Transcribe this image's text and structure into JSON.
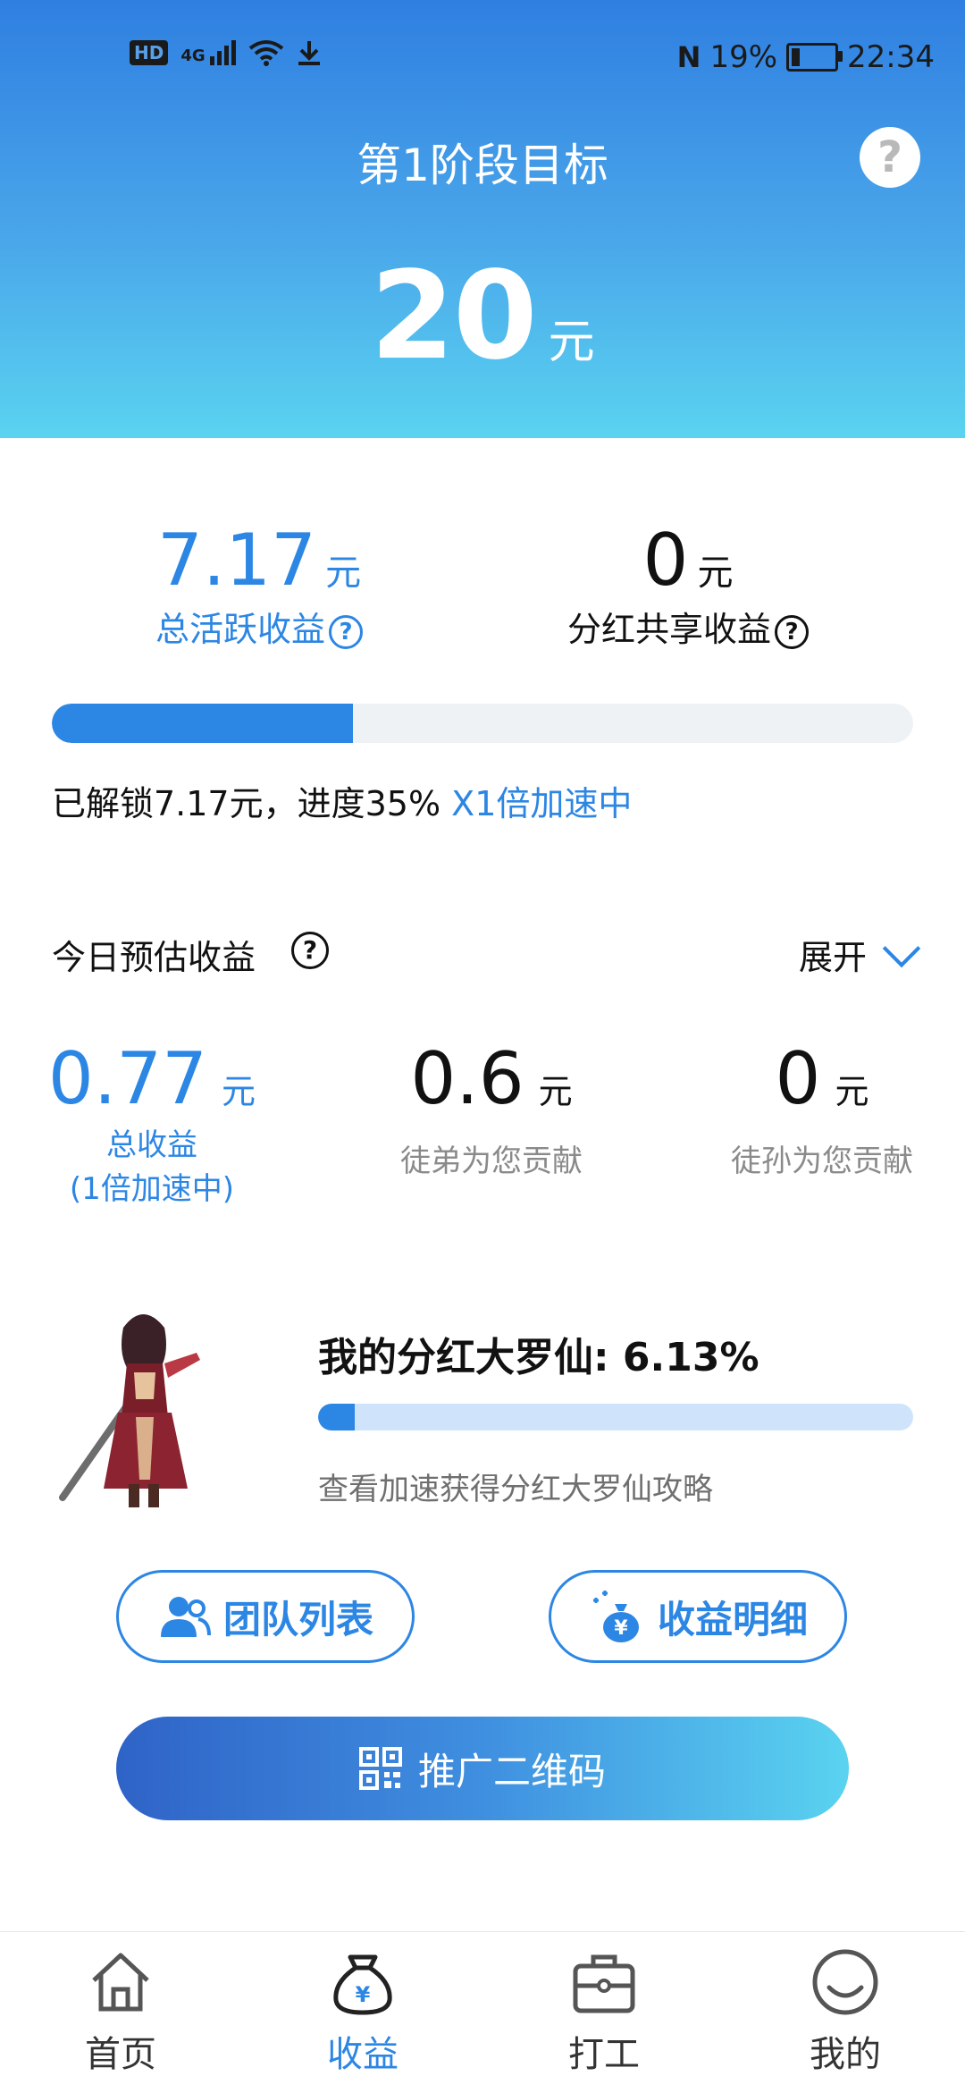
{
  "status_bar": {
    "network": "4G",
    "hd": "HD",
    "battery": "19%",
    "battery_level": 0.19,
    "time": "22:34"
  },
  "header": {
    "stage_title": "第1阶段目标",
    "target_value": "20",
    "target_unit": "元",
    "help_icon": "question-circle-icon"
  },
  "income": {
    "total_active": {
      "value": "7.17",
      "unit": "元",
      "label": "总活跃收益"
    },
    "dividend_share": {
      "value": "0",
      "unit": "元",
      "label": "分红共享收益"
    }
  },
  "progress": {
    "percent": 0.35,
    "text": "已解锁7.17元，进度35%",
    "speed_text": "X1倍加速中"
  },
  "today": {
    "title": "今日预估收益",
    "expand_label": "展开",
    "total": {
      "value": "0.77",
      "unit": "元",
      "label": "总收益",
      "sub": "(1倍加速中)"
    },
    "apprentice": {
      "value": "0.6",
      "unit": "元",
      "label": "徒弟为您贡献"
    },
    "grand_apprentice": {
      "value": "0",
      "unit": "元",
      "label": "徒孙为您贡献"
    }
  },
  "dividend": {
    "title": "我的分红大罗仙: 6.13%",
    "percent": 0.0613,
    "guide": "查看加速获得分红大罗仙攻略"
  },
  "buttons": {
    "team_list": "团队列表",
    "income_detail": "收益明细",
    "promo_qr": "推广二维码"
  },
  "colors": {
    "accent": "#2c86e4",
    "header_top": "#2f7fe1",
    "header_bottom": "#5ad3f0"
  },
  "nav": {
    "items": [
      {
        "label": "首页",
        "icon": "home-icon",
        "active": false
      },
      {
        "label": "收益",
        "icon": "money-bag-icon",
        "active": true
      },
      {
        "label": "打工",
        "icon": "briefcase-icon",
        "active": false
      },
      {
        "label": "我的",
        "icon": "profile-icon",
        "active": false
      }
    ]
  }
}
